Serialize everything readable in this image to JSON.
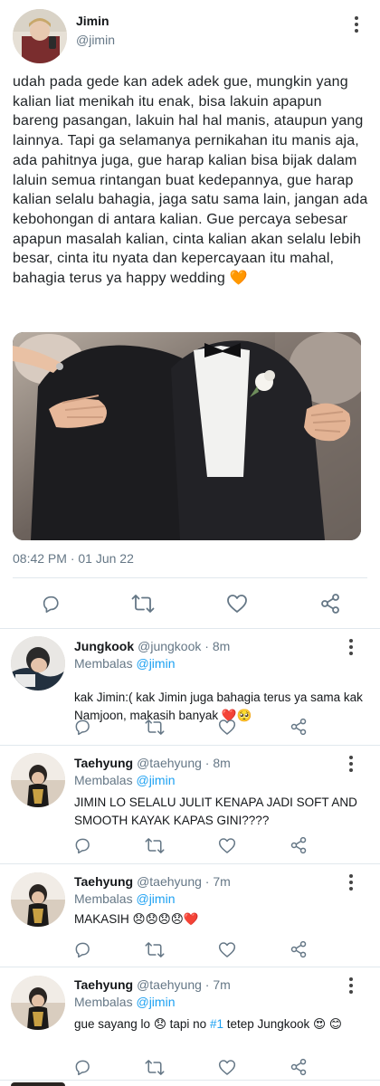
{
  "main": {
    "name": "Jimin",
    "handle": "@jimin",
    "text": "udah pada gede kan adek adek gue, mungkin yang kalian liat menikah itu enak, bisa lakuin apapun bareng pasangan, lakuin hal hal manis, ataupun yang lainnya. Tapi ga selamanya pernikahan itu manis aja, ada pahitnya juga, gue harap kalian bisa bijak dalam laluin semua rintangan buat kedepannya, gue harap kalian selalu bahagia, jaga satu sama lain, jangan ada kebohongan di antara kalian. Gue percaya sebesar apapun masalah kalian, cinta kalian akan selalu lebih besar, cinta itu nyata dan kepercayaan itu mahal, bahagia terus ya happy wedding",
    "text_emoji": "🧡",
    "timestamp": "08:42 PM · 01 Jun 22"
  },
  "replies": [
    {
      "name": "Jungkook",
      "handle_time": "@jungkook · 8m",
      "replying_prefix": "Membalas",
      "replying_to": "@jimin",
      "text": "kak Jimin:( kak Jimin juga bahagia terus ya sama kak Namjoon, makasih banyak ❤️🥺"
    },
    {
      "name": "Taehyung",
      "handle_time": "@taehyung · 8m",
      "replying_prefix": "Membalas",
      "replying_to": "@jimin",
      "text": "JIMIN LO SELALU JULIT KENAPA JADI SOFT AND SMOOTH KAYAK KAPAS GINI????"
    },
    {
      "name": "Taehyung",
      "handle_time": "@taehyung · 7m",
      "replying_prefix": "Membalas",
      "replying_to": "@jimin",
      "text": "MAKASIH 😞😞😞😞❤️"
    },
    {
      "name": "Taehyung",
      "handle_time": "@taehyung · 7m",
      "replying_prefix": "Membalas",
      "replying_to": "@jimin",
      "text_before": "gue sayang lo 😞 tapi no ",
      "text_mention": "#1",
      "text_after": " tetep Jungkook 😍 😊"
    }
  ],
  "icons": {
    "reply": "reply-icon",
    "retweet": "retweet-icon",
    "like": "heart-icon",
    "share": "share-icon",
    "menu": "more-vertical-icon"
  },
  "colors": {
    "accent": "#1da1f2",
    "secondary_text": "#657786",
    "divider": "#e1e8ed",
    "icon": "#657786"
  }
}
